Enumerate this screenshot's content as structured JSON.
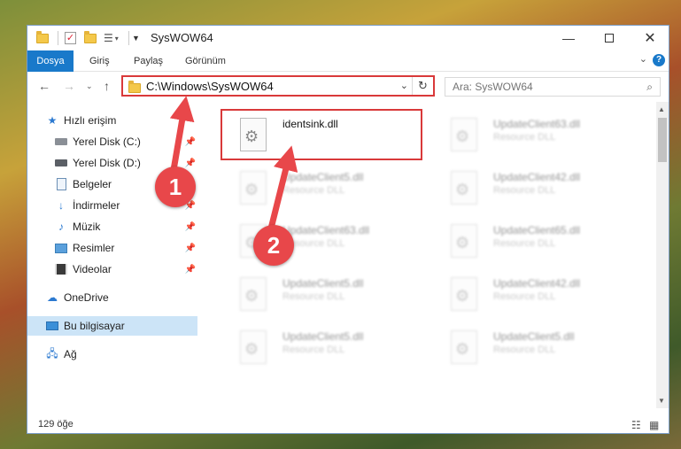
{
  "window": {
    "title": "SysWOW64"
  },
  "ribbon": {
    "tabs": [
      {
        "label": "Dosya",
        "active": true
      },
      {
        "label": "Giriş",
        "active": false
      },
      {
        "label": "Paylaş",
        "active": false
      },
      {
        "label": "Görünüm",
        "active": false
      }
    ]
  },
  "address": {
    "path": "C:\\Windows\\SysWOW64"
  },
  "search": {
    "placeholder": "Ara: SysWOW64"
  },
  "sidebar": {
    "items": [
      {
        "label": "Hızlı erişim",
        "icon": "star-icon"
      },
      {
        "label": "Yerel Disk (C:)",
        "icon": "drive-icon"
      },
      {
        "label": "Yerel Disk (D:)",
        "icon": "drive-icon"
      },
      {
        "label": "Belgeler",
        "icon": "document-icon"
      },
      {
        "label": "İndirmeler",
        "icon": "download-icon"
      },
      {
        "label": "Müzik",
        "icon": "music-icon"
      },
      {
        "label": "Resimler",
        "icon": "pictures-icon"
      },
      {
        "label": "Videolar",
        "icon": "video-icon"
      },
      {
        "label": "OneDrive",
        "icon": "cloud-icon"
      },
      {
        "label": "Bu bilgisayar",
        "icon": "computer-icon"
      },
      {
        "label": "Ağ",
        "icon": "network-icon"
      }
    ]
  },
  "files": [
    {
      "name": "identsink.dll",
      "type": ""
    },
    {
      "name": "UpdateClient63.dll",
      "type": "Resource DLL"
    },
    {
      "name": "UpdateClient5.dll",
      "type": "Resource DLL"
    },
    {
      "name": "UpdateClient42.dll",
      "type": "Resource DLL"
    },
    {
      "name": "UpdateClient63.dll",
      "type": "Resource DLL"
    },
    {
      "name": "UpdateClient65.dll",
      "type": "Resource DLL"
    },
    {
      "name": "UpdateClient5.dll",
      "type": "Resource DLL"
    },
    {
      "name": "UpdateClient42.dll",
      "type": "Resource DLL"
    },
    {
      "name": "UpdateClient5.dll",
      "type": "Resource DLL"
    },
    {
      "name": "UpdateClient5.dll",
      "type": "Resource DLL"
    }
  ],
  "status": {
    "count": "129 öğe"
  },
  "annotations": {
    "step1": "1",
    "step2": "2"
  },
  "colors": {
    "accent": "#1979ca",
    "highlight": "#d9393a",
    "badge": "#e8474a"
  }
}
